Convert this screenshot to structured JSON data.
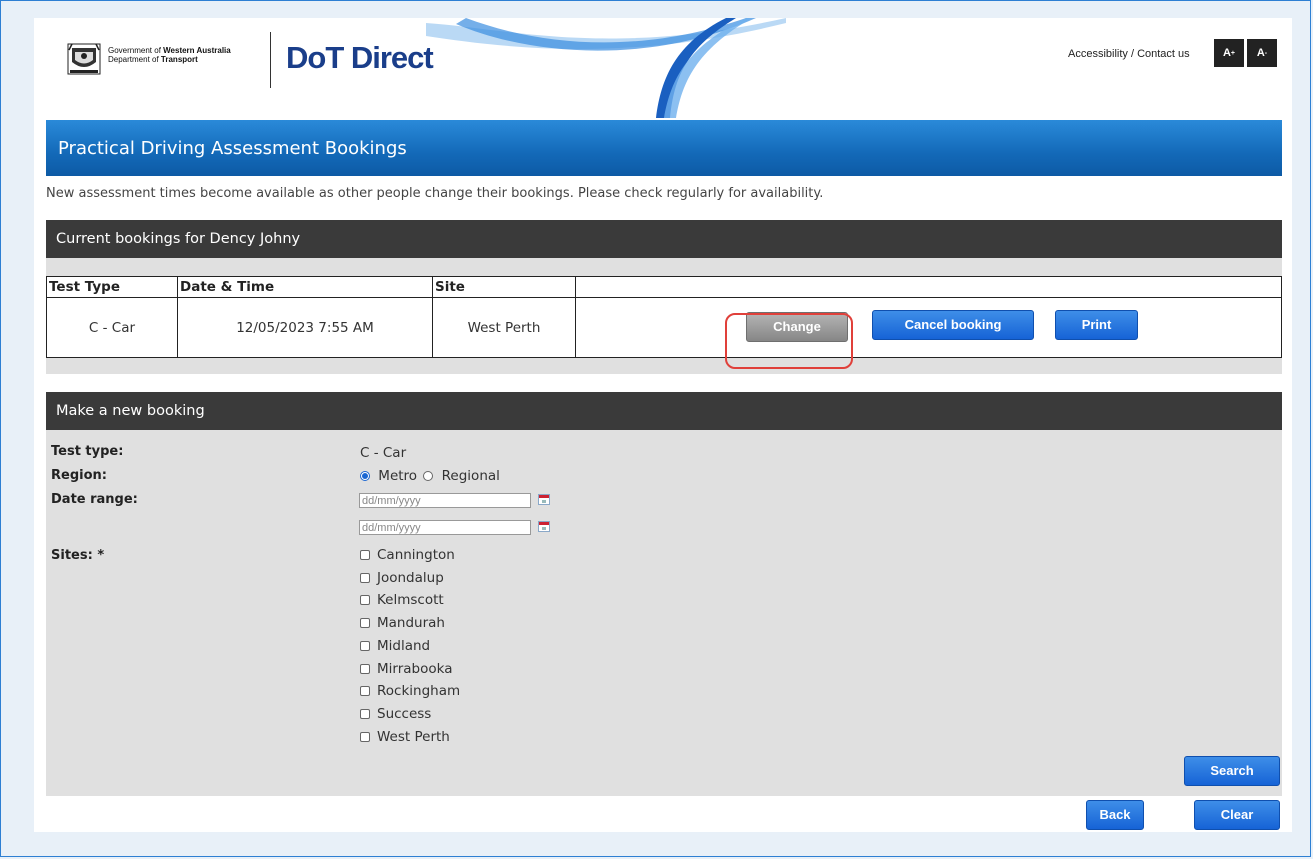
{
  "header": {
    "gov_line1_prefix": "Government of ",
    "gov_line1_bold": "Western Australia",
    "gov_line2_prefix": "Department of ",
    "gov_line2_bold": "Transport",
    "logo_text": "DoT Direct",
    "accessibility_link": "Accessibility / Contact us",
    "font_increase": "A",
    "font_decrease": "A",
    "font_increase_sup": "+",
    "font_decrease_sup": "-"
  },
  "banner": {
    "title": "Practical Driving Assessment Bookings"
  },
  "intro": "New assessment times become available as other people change their bookings. Please check regularly for availability.",
  "current": {
    "heading": "Current bookings for Dency Johny",
    "columns": [
      "Test Type",
      "Date & Time",
      "Site",
      ""
    ],
    "row": {
      "test_type": "C - Car",
      "date_time": "12/05/2023 7:55 AM",
      "site": "West Perth"
    },
    "buttons": {
      "change": "Change",
      "cancel": "Cancel booking",
      "print": "Print"
    }
  },
  "new_booking": {
    "heading": "Make a new booking",
    "test_type_label": "Test type:",
    "test_type_value": "C - Car",
    "region_label": "Region:",
    "region_options": [
      "Metro",
      "Regional"
    ],
    "region_selected": "Metro",
    "date_range_label": "Date range:",
    "date_from_placeholder": "dd/mm/yyyy",
    "date_to_placeholder": "dd/mm/yyyy",
    "sites_label": "Sites: *",
    "sites": [
      "Cannington",
      "Joondalup",
      "Kelmscott",
      "Mandurah",
      "Midland",
      "Mirrabooka",
      "Rockingham",
      "Success",
      "West Perth"
    ],
    "search_button": "Search"
  },
  "footer": {
    "back_button": "Back",
    "clear_button": "Clear"
  },
  "colors": {
    "accent_blue": "#1663d6",
    "banner_blue": "#1369b8",
    "highlight_red": "#e0403a",
    "section_dark": "#3a3a3a"
  }
}
